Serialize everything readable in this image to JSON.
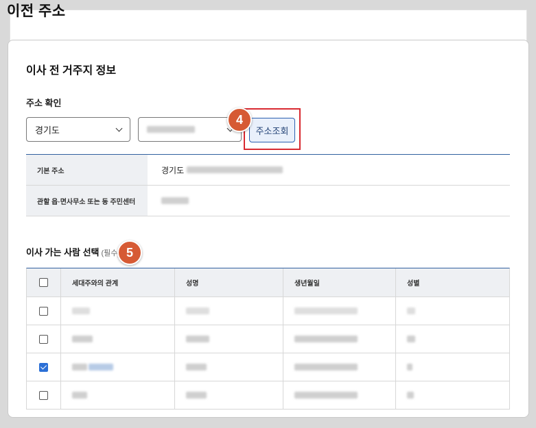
{
  "page": {
    "title": "이전 주소"
  },
  "section": {
    "title": "이사 전 거주지 정보"
  },
  "address": {
    "label": "주소 확인",
    "province_select": "경기도",
    "search_button": "주소조회",
    "step_badge": "4"
  },
  "info": {
    "basic_address_label": "기본 주소",
    "basic_address_value": "경기도",
    "office_label": "관할 읍·면사무소 또는 동 주민센터"
  },
  "people": {
    "title": "이사 가는 사람 선택",
    "required": "(필수)",
    "step_badge": "5",
    "columns": [
      "세대주와의 관계",
      "성명",
      "생년월일",
      "성별"
    ],
    "rows": [
      {
        "checked": false
      },
      {
        "checked": false
      },
      {
        "checked": true
      },
      {
        "checked": false
      }
    ]
  },
  "colors": {
    "accent": "#2f5f9e",
    "highlight": "#d8282f",
    "badge": "#d65a34",
    "checkbox_checked": "#2b6fd6"
  }
}
